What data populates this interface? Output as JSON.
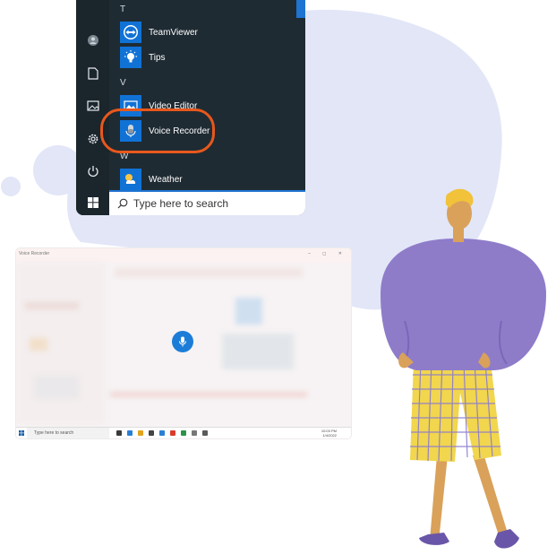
{
  "start_menu": {
    "sections": [
      {
        "letter": "T",
        "apps": [
          {
            "label": "TeamViewer",
            "icon": "teamviewer-icon"
          },
          {
            "label": "Tips",
            "icon": "lightbulb-icon"
          }
        ]
      },
      {
        "letter": "V",
        "apps": [
          {
            "label": "Video Editor",
            "icon": "video-editor-icon"
          },
          {
            "label": "Voice Recorder",
            "icon": "microphone-icon"
          }
        ]
      },
      {
        "letter": "W",
        "apps": [
          {
            "label": "Weather",
            "icon": "weather-icon"
          }
        ]
      }
    ],
    "rail_icons": [
      "user-icon",
      "document-icon",
      "pictures-icon",
      "settings-icon",
      "power-icon"
    ],
    "search_placeholder": "Type here to search",
    "highlight_color": "#e8581c",
    "accent_color": "#1172d6"
  },
  "recorder_window": {
    "title": "Voice Recorder",
    "controls": "– ◻ ✕",
    "taskbar_search": "Type here to search",
    "clock_time": "10:03 PM",
    "clock_date": "1/4/2022"
  },
  "colors": {
    "blob": "#e2e6f7",
    "sweater": "#8e7cc9",
    "pants": "#f1d64e",
    "shoes": "#6a56a8"
  }
}
